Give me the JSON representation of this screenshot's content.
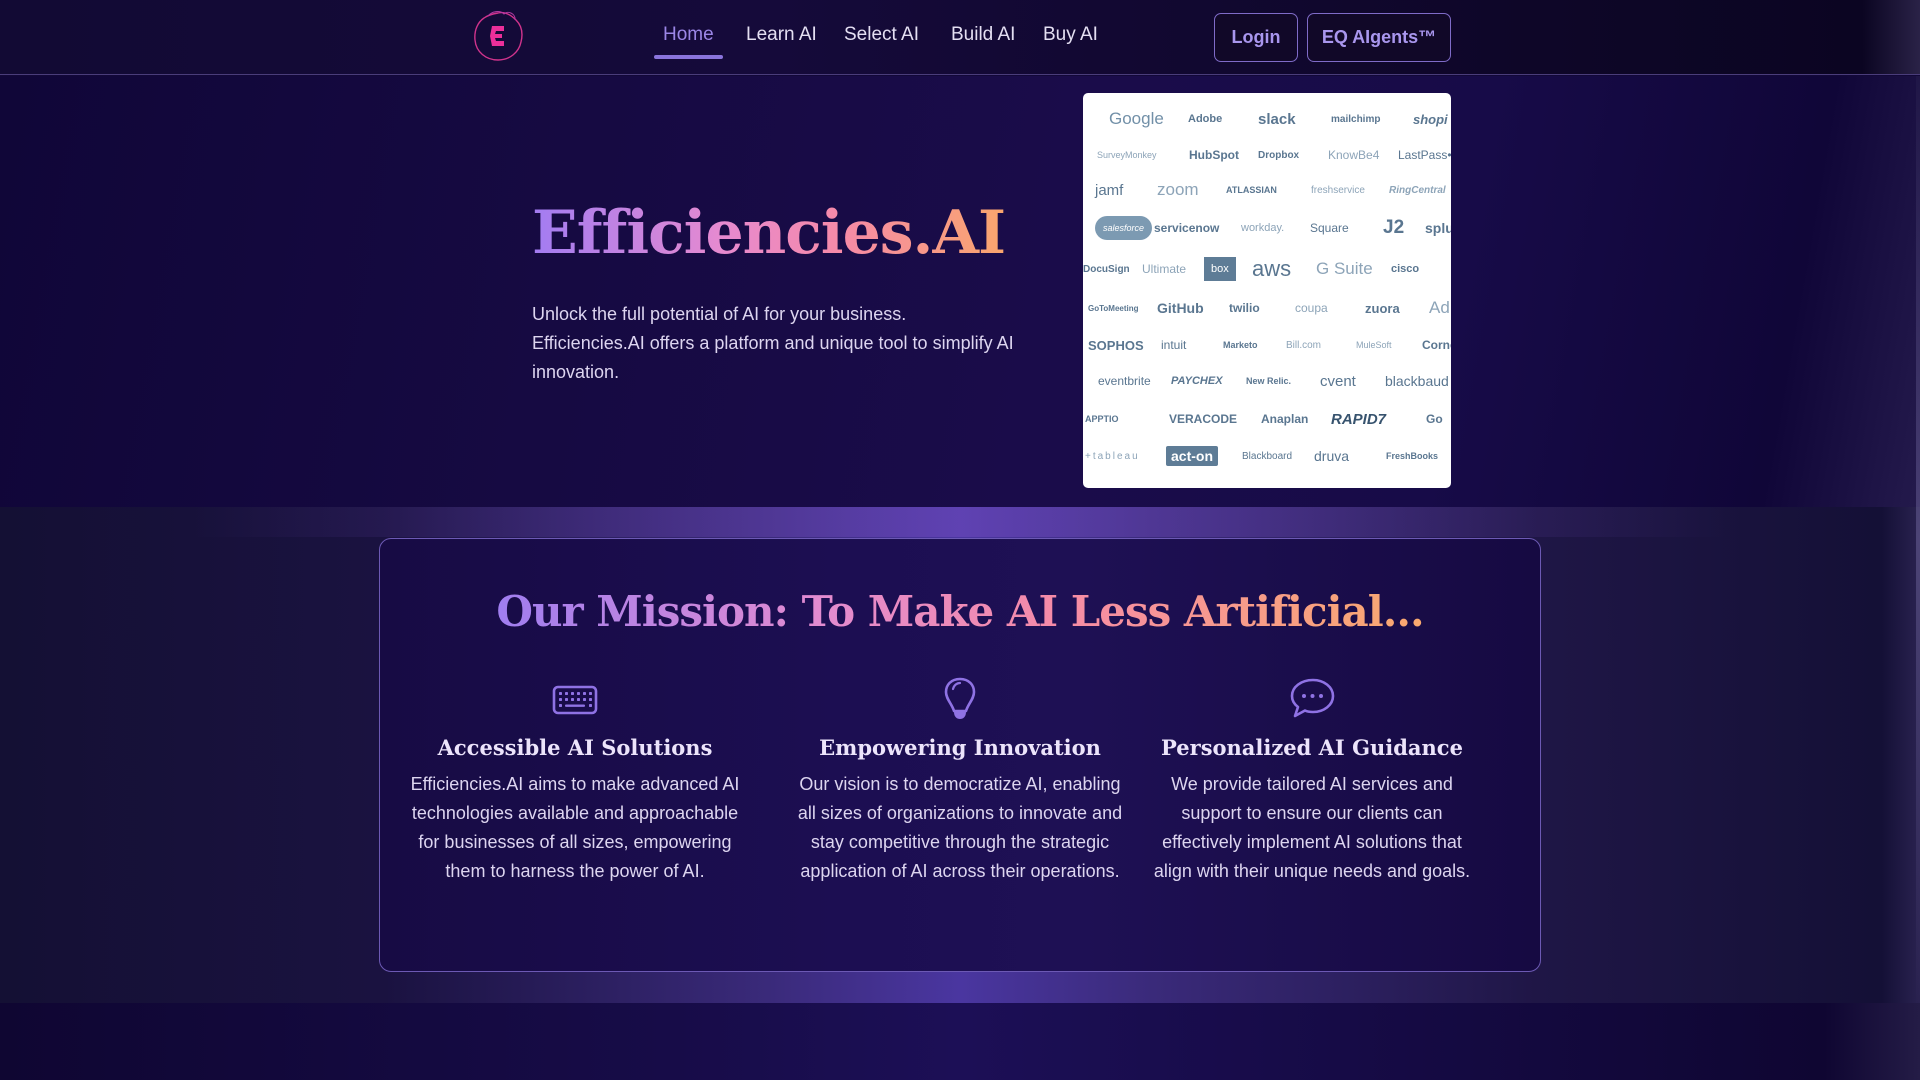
{
  "header": {
    "logo": {
      "letter": "E",
      "name": "efficiencies-logo",
      "ring_color": "#e0368f"
    },
    "nav": [
      {
        "label": "Home",
        "active": true
      },
      {
        "label": "Learn AI",
        "active": false
      },
      {
        "label": "Select AI",
        "active": false
      },
      {
        "label": "Build AI",
        "active": false
      },
      {
        "label": "Buy AI",
        "active": false
      }
    ],
    "login_label": "Login",
    "agents_label": "EQ AIgents™"
  },
  "hero": {
    "title": "Efficiencies.AI",
    "description": "Unlock the full potential of AI for your business. Efficiencies.AI offers a platform and unique tool to simplify AI innovation.",
    "partner_logos": [
      [
        "Google",
        "Adobe",
        "slack",
        "mailchimp",
        "shopi"
      ],
      [
        "SurveyMonkey",
        "HubSpot",
        "Dropbox",
        "KnowBe4",
        "LastPass•••"
      ],
      [
        "jamf",
        "zoom",
        "ATLASSIAN",
        "freshservice",
        "RingCentral"
      ],
      [
        "salesforce",
        "servicenow",
        "workday.",
        "Square",
        "J2",
        "splu"
      ],
      [
        "DocuSign",
        "Ultimate",
        "box",
        "aws",
        "G Suite",
        "cisco"
      ],
      [
        "GoToMeeting",
        "GitHub",
        "twilio",
        "coupa",
        "zuora",
        "Ad"
      ],
      [
        "SOPHOS",
        "intuit",
        "Marketo",
        "Bill.com",
        "MuleSoft",
        "Corne"
      ],
      [
        "eventbrite",
        "PAYCHEX",
        "New Relic.",
        "cvent",
        "blackbaud"
      ],
      [
        "APPTIO",
        "VERACODE",
        "Anaplan",
        "RAPID7",
        "Go"
      ],
      [
        "+tableau",
        "act-on",
        "Blackboard",
        "druva",
        "FreshBooks"
      ]
    ]
  },
  "mission": {
    "title": "Our Mission: To Make AI Less Artificial...",
    "columns": [
      {
        "icon": "keyboard-icon",
        "title": "Accessible AI Solutions",
        "text": "Efficiencies.AI aims to make advanced AI technologies available and approachable for businesses of all sizes, empowering them to harness the power of AI."
      },
      {
        "icon": "lightbulb-icon",
        "title": "Empowering Innovation",
        "text": "Our vision is to democratize AI, enabling all sizes of organizations to innovate and stay competitive through the strategic application of AI across their operations."
      },
      {
        "icon": "chat-bubble-icon",
        "title": "Personalized AI Guidance",
        "text": "We provide tailored AI services and support to ensure our clients can effectively implement AI solutions that align with their unique needs and goals."
      }
    ]
  },
  "colors": {
    "accent": "#8a74dc",
    "button_text": "#a996ee",
    "gradient_start": "#a27cf2",
    "gradient_mid": "#f68aa8",
    "gradient_end": "#f9a66d",
    "background": "#160a42"
  }
}
